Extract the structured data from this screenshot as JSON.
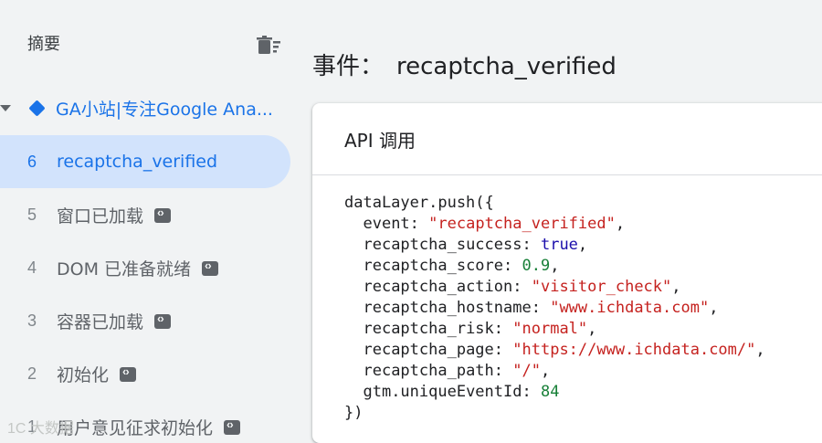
{
  "sidebar": {
    "title": "摘要",
    "container": {
      "label": "GA小站|专注Google Ana..."
    },
    "events": [
      {
        "num": "6",
        "label": "recaptcha_verified",
        "active": true,
        "has_tag": false
      },
      {
        "num": "5",
        "label": "窗口已加载",
        "active": false,
        "has_tag": true
      },
      {
        "num": "4",
        "label": "DOM 已准备就绪",
        "active": false,
        "has_tag": true
      },
      {
        "num": "3",
        "label": "容器已加载",
        "active": false,
        "has_tag": true
      },
      {
        "num": "2",
        "label": "初始化",
        "active": false,
        "has_tag": true
      },
      {
        "num": "1",
        "label": "用户意见征求初始化",
        "active": false,
        "has_tag": true
      }
    ]
  },
  "main": {
    "title_prefix": "事件：",
    "title_value": "recaptcha_verified",
    "card_title": "API 调用",
    "code": {
      "open": "dataLayer.push({",
      "lines": [
        {
          "key": "event",
          "value": "\"recaptcha_verified\"",
          "type": "string"
        },
        {
          "key": "recaptcha_success",
          "value": "true",
          "type": "bool"
        },
        {
          "key": "recaptcha_score",
          "value": "0.9",
          "type": "number"
        },
        {
          "key": "recaptcha_action",
          "value": "\"visitor_check\"",
          "type": "string"
        },
        {
          "key": "recaptcha_hostname",
          "value": "\"www.ichdata.com\"",
          "type": "string"
        },
        {
          "key": "recaptcha_risk",
          "value": "\"normal\"",
          "type": "string"
        },
        {
          "key": "recaptcha_page",
          "value": "\"https://www.ichdata.com/\"",
          "type": "string"
        },
        {
          "key": "recaptcha_path",
          "value": "\"/\"",
          "type": "string"
        },
        {
          "key": "gtm.uniqueEventId",
          "value": "84",
          "type": "number"
        }
      ],
      "close": "})"
    }
  },
  "watermark": "1C 大数据"
}
